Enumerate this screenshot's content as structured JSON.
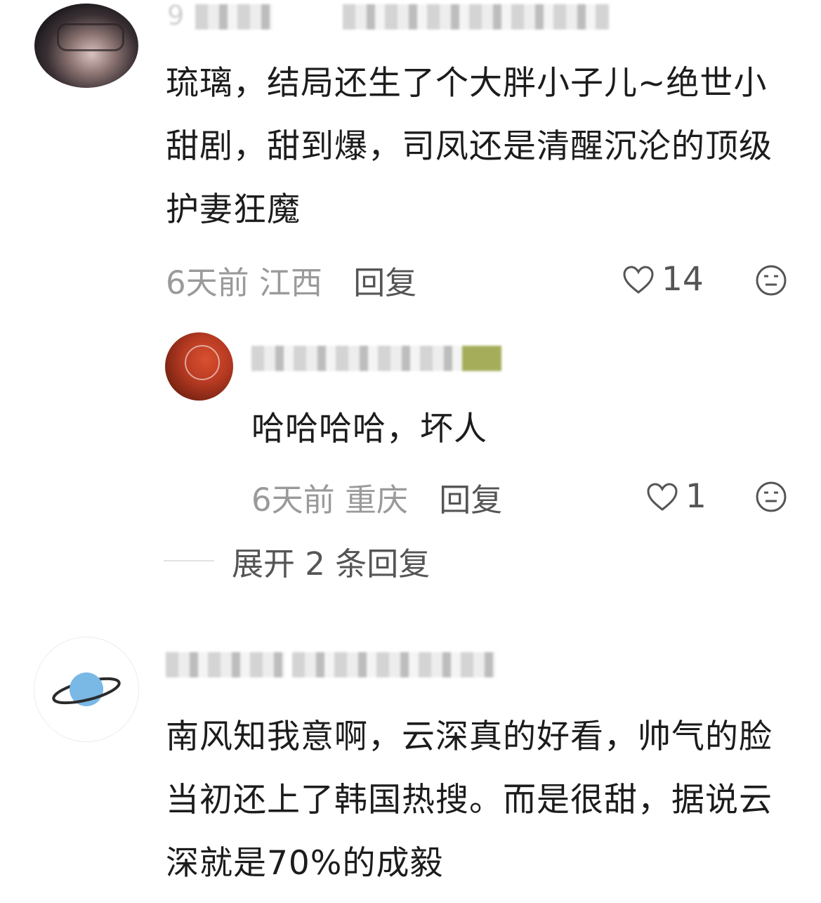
{
  "comments": [
    {
      "avatar": "user-photo",
      "text": "琉璃，结局还生了个大胖小子儿~绝世小甜剧，甜到爆，司凤还是清醒沉沦的顶级护妻狂魔",
      "time": "6天前",
      "location": "江西",
      "reply_label": "回复",
      "likes": "14"
    },
    {
      "avatar": "user-photo",
      "text": "哈哈哈哈，坏人",
      "time": "6天前",
      "location": "重庆",
      "reply_label": "回复",
      "likes": "1"
    },
    {
      "avatar": "planet-icon",
      "text": "南风知我意啊，云深真的好看，帅气的脸当初还上了韩国热搜。而是很甜，据说云深就是70%的成毅"
    }
  ],
  "expand": {
    "label": "展开 2 条回复"
  },
  "icons": {
    "like": "heart-outline-icon",
    "dislike": "neutral-face-icon"
  },
  "colors": {
    "text": "#1c1c1c",
    "meta": "#9a9a9a",
    "action": "#555555",
    "planet": "#7ab8e6"
  }
}
